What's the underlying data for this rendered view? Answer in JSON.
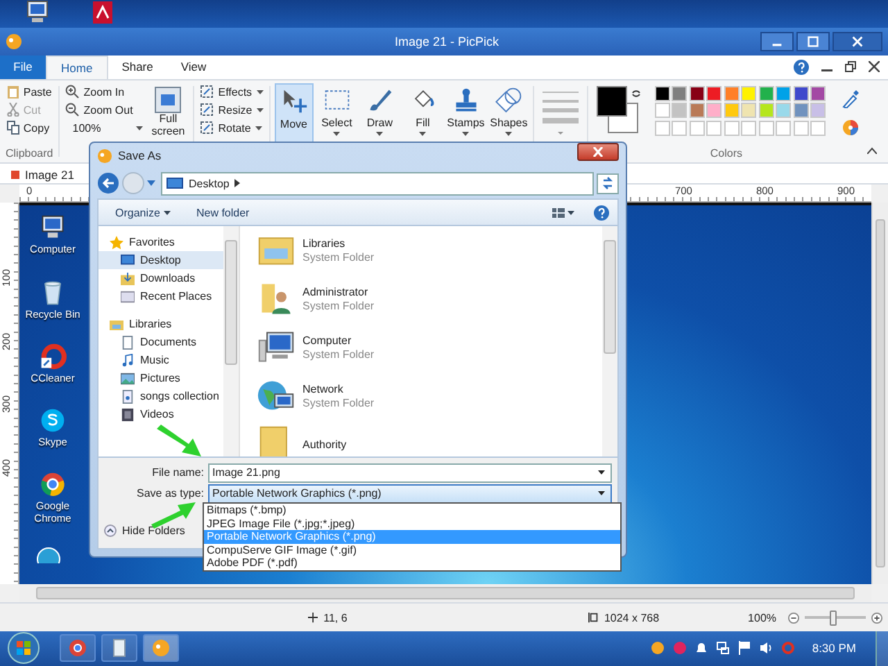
{
  "app": {
    "title": "Image 21 - PicPick"
  },
  "ribbon_tabs": [
    {
      "label": "File",
      "selected": false,
      "kind": "file"
    },
    {
      "label": "Home",
      "selected": true,
      "kind": "tab"
    },
    {
      "label": "Share",
      "selected": false,
      "kind": "tab"
    },
    {
      "label": "View",
      "selected": false,
      "kind": "tab"
    }
  ],
  "clipboard": {
    "label": "Clipboard",
    "items": [
      {
        "label": "Paste",
        "disabled": false,
        "kind": "paste"
      },
      {
        "label": "Cut",
        "disabled": true,
        "kind": "cut"
      },
      {
        "label": "Copy",
        "disabled": false,
        "kind": "copy"
      }
    ]
  },
  "view_group": {
    "zoom_in": "Zoom In",
    "zoom_out": "Zoom Out",
    "zoom_level": "100%",
    "full_screen": "Full screen"
  },
  "image_group": {
    "items": [
      "Effects",
      "Resize",
      "Rotate"
    ]
  },
  "tools": [
    {
      "label": "Move",
      "selected": true,
      "kind": "move"
    },
    {
      "label": "Select",
      "selected": false,
      "kind": "select"
    },
    {
      "label": "Draw",
      "selected": false,
      "kind": "draw"
    },
    {
      "label": "Fill",
      "selected": false,
      "kind": "fill"
    },
    {
      "label": "Stamps",
      "selected": false,
      "kind": "stamps"
    },
    {
      "label": "Shapes",
      "selected": false,
      "kind": "shapes"
    }
  ],
  "colors": {
    "label": "Colors",
    "current": [
      {
        "color": "#000000"
      },
      {
        "color": "#ffffff"
      }
    ],
    "swatches": [
      {
        "color": "#000000"
      },
      {
        "color": "#7f7f7f"
      },
      {
        "color": "#880015"
      },
      {
        "color": "#ed1c24"
      },
      {
        "color": "#ff7f27"
      },
      {
        "color": "#fff200"
      },
      {
        "color": "#22b14c"
      },
      {
        "color": "#00a2e8"
      },
      {
        "color": "#3f48cc"
      },
      {
        "color": "#a349a4"
      },
      {
        "color": "#ffffff"
      },
      {
        "color": "#c3c3c3"
      },
      {
        "color": "#b97a57"
      },
      {
        "color": "#ffaec9"
      },
      {
        "color": "#ffc90e"
      },
      {
        "color": "#efe4b0"
      },
      {
        "color": "#b5e61d"
      },
      {
        "color": "#99d9ea"
      },
      {
        "color": "#7092be"
      },
      {
        "color": "#c8bfe7"
      }
    ]
  },
  "document_tab": {
    "label": "Image 21"
  },
  "top_ruler": [
    "0",
    "700",
    "800",
    "900"
  ],
  "left_ruler": [
    "100",
    "200",
    "300",
    "400"
  ],
  "canvas_icons": [
    {
      "label": "Computer",
      "kind": "computer"
    },
    {
      "label": "Recycle Bin",
      "kind": "bin"
    },
    {
      "label": "CCleaner",
      "kind": "ccleaner"
    },
    {
      "label": "Skype",
      "kind": "skype"
    },
    {
      "label": "Google Chrome",
      "kind": "chrome"
    }
  ],
  "status_bar": {
    "position": "11, 6",
    "image_size": "1024 x 768",
    "zoom": "100%",
    "level": 0.45
  },
  "taskbar": {
    "apps": [
      {
        "kind": "chrome",
        "selected": false
      },
      {
        "kind": "notes",
        "selected": false
      },
      {
        "kind": "picpick",
        "selected": true
      }
    ],
    "clock": "8:30 PM"
  },
  "dialog": {
    "title": "Save As",
    "path": "Desktop",
    "toolbar": [
      "Organize",
      "New folder"
    ],
    "nav": [
      {
        "label": "Favorites",
        "kind": "star",
        "selected": false,
        "children": [
          {
            "label": "Desktop",
            "kind": "desktop",
            "selected": true
          },
          {
            "label": "Downloads",
            "kind": "downloads",
            "selected": false
          },
          {
            "label": "Recent Places",
            "kind": "recent",
            "selected": false
          }
        ]
      },
      {
        "label": "Libraries",
        "kind": "library",
        "selected": false,
        "children": [
          {
            "label": "Documents",
            "kind": "documents",
            "selected": false
          },
          {
            "label": "Music",
            "kind": "music",
            "selected": false
          },
          {
            "label": "Pictures",
            "kind": "pictures",
            "selected": false
          },
          {
            "label": "songs collection",
            "kind": "songs",
            "selected": false
          },
          {
            "label": "Videos",
            "kind": "videos",
            "selected": false
          }
        ]
      }
    ],
    "items": [
      {
        "name": "Libraries",
        "type": "System Folder",
        "kind": "libraries"
      },
      {
        "name": "Administrator",
        "type": "System Folder",
        "kind": "user"
      },
      {
        "name": "Computer",
        "type": "System Folder",
        "kind": "computer"
      },
      {
        "name": "Network",
        "type": "System Folder",
        "kind": "network"
      },
      {
        "name": "Authority",
        "kind": "folder"
      }
    ],
    "file_name_label": "File name:",
    "file_name": "Image 21.png",
    "type_label": "Save as type:",
    "type_value": "Portable Network Graphics (*.png)",
    "type_options": [
      {
        "label": "Bitmaps (*.bmp)",
        "selected": false
      },
      {
        "label": "JPEG Image File (*.jpg;*.jpeg)",
        "selected": false
      },
      {
        "label": "Portable Network Graphics (*.png)",
        "selected": true
      },
      {
        "label": "CompuServe GIF Image (*.gif)",
        "selected": false
      },
      {
        "label": "Adobe PDF (*.pdf)",
        "selected": false
      }
    ],
    "hide_folders": "Hide Folders"
  }
}
